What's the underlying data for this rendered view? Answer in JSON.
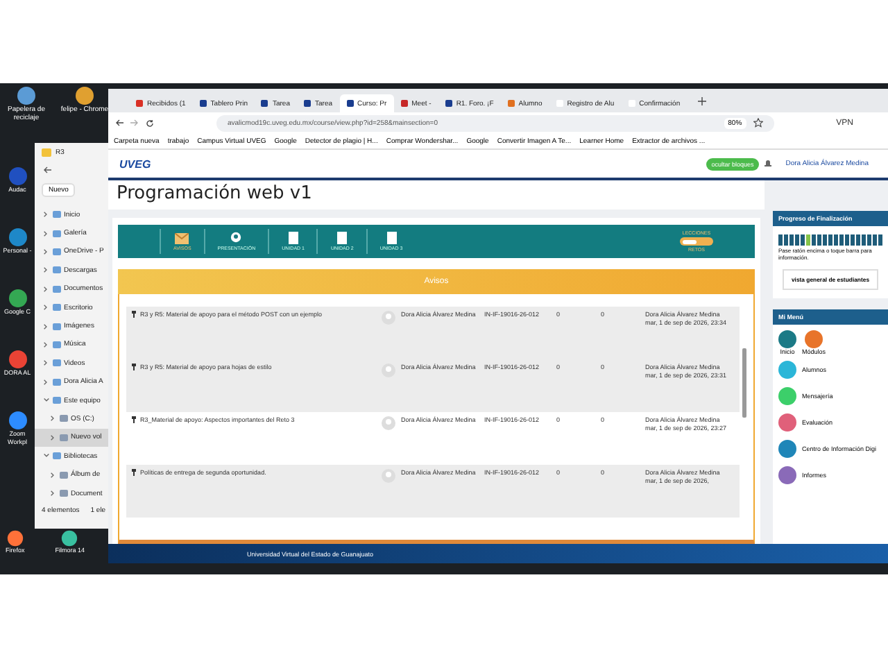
{
  "desktop_icons": [
    {
      "label": "Papelera de reciclaje",
      "color": "#5b9bd5"
    },
    {
      "label": "felipe - Chrome",
      "color": "#e0a030"
    }
  ],
  "desktop_side_icons": [
    {
      "label": "Audac",
      "color": "#2050c0"
    },
    {
      "label": "Personal -",
      "color": "#1e88c8"
    },
    {
      "label": "Google C",
      "color": "#34a853"
    },
    {
      "label": "DORA AL",
      "color": "#ea4335"
    },
    {
      "label": "Zoom Workpl",
      "color": "#2d8cff"
    }
  ],
  "desktop_bottom_icons": [
    {
      "label": "Firefox",
      "color": "#ff7139"
    },
    {
      "label": "Filmora 14",
      "color": "#39c0a0"
    }
  ],
  "explorer": {
    "title": "R3",
    "new_button": "Nuevo",
    "tree": [
      {
        "label": "Inicio",
        "expanded": false
      },
      {
        "label": "Galería",
        "expanded": false
      },
      {
        "label": "OneDrive - P",
        "expanded": false
      },
      {
        "label": "Descargas",
        "expanded": false
      },
      {
        "label": "Documentos",
        "expanded": false
      },
      {
        "label": "Escritorio",
        "expanded": false
      },
      {
        "label": "Imágenes",
        "expanded": false
      },
      {
        "label": "Música",
        "expanded": false
      },
      {
        "label": "Videos",
        "expanded": false
      },
      {
        "label": "Dora Alicia A",
        "expanded": false
      },
      {
        "label": "Este equipo",
        "expanded": true,
        "children": [
          {
            "label": "OS (C:)",
            "selected": false
          },
          {
            "label": "Nuevo vol",
            "selected": true
          }
        ]
      },
      {
        "label": "Bibliotecas",
        "expanded": true,
        "children": [
          {
            "label": "Álbum de",
            "selected": false
          },
          {
            "label": "Document",
            "selected": false
          }
        ]
      }
    ],
    "status": [
      "4 elementos",
      "1 ele"
    ]
  },
  "browser": {
    "tabs": [
      {
        "label": "Recibidos (1",
        "selected": false,
        "color": "#d93025"
      },
      {
        "label": "Tablero Prin",
        "selected": false,
        "color": "#1a3d8f"
      },
      {
        "label": "Tarea",
        "selected": false,
        "color": "#1a3d8f"
      },
      {
        "label": "Tarea",
        "selected": false,
        "color": "#1a3d8f"
      },
      {
        "label": "Curso: Pr",
        "selected": true,
        "color": "#1a3d8f"
      },
      {
        "label": "Meet -",
        "selected": false,
        "color": "#c62828"
      },
      {
        "label": "R1. Foro. ¡F",
        "selected": false,
        "color": "#1a3d8f"
      },
      {
        "label": "Alumno",
        "selected": false,
        "color": "#e07020"
      },
      {
        "label": "Registro de Alu",
        "selected": false,
        "color": "#ffffff"
      },
      {
        "label": "Confirmación",
        "selected": false,
        "color": "#ffffff"
      }
    ],
    "address": "avalicmod19c.uveg.edu.mx/course/view.php?id=258&mainsection=0",
    "zoom": "80%",
    "vpn": "VPN",
    "bookmarks": [
      "Carpeta nueva",
      "trabajo",
      "Campus Virtual UVEG",
      "Google",
      "Detector de plagio | H...",
      "Comprar Wondershar...",
      "Google",
      "Convertir Imagen A Te...",
      "Learner Home",
      "Extractor de archivos ..."
    ]
  },
  "page": {
    "logo": "UVEG",
    "hide_blocks": "ocultar bloques",
    "user": "Dora Alicia Álvarez Medina",
    "title": "Programación web v1",
    "nav": [
      {
        "label": "AVISOS",
        "selected": true,
        "kind": "mail"
      },
      {
        "label": "PRESENTACIÓN",
        "selected": false,
        "kind": "person"
      },
      {
        "label": "UNIDAD 1",
        "selected": false,
        "kind": "unit"
      },
      {
        "label": "UNIDAD 2",
        "selected": false,
        "kind": "unit"
      },
      {
        "label": "UNIDAD 3",
        "selected": false,
        "kind": "unit"
      }
    ],
    "switch": {
      "top": "LECCIONES",
      "bottom": "RETOS",
      "on": true
    },
    "section": "Avisos",
    "rows": [
      {
        "title": "R3 y R5: Material de apoyo para el método POST con un ejemplo",
        "author": "Dora Alicia Álvarez Medina",
        "group": "IN-IF-19016-26-012",
        "replies": "0",
        "unread": "0",
        "last_author": "Dora Alicia Álvarez Medina",
        "last_date": "mar, 1 de sep de 2026, 23:34",
        "shaded": true
      },
      {
        "title": "R3 y R5: Material de apoyo para hojas de estilo",
        "author": "Dora Alicia Álvarez Medina",
        "group": "IN-IF-19016-26-012",
        "replies": "0",
        "unread": "0",
        "last_author": "Dora Alicia Álvarez Medina",
        "last_date": "mar, 1 de sep de 2026, 23:31",
        "shaded": true
      },
      {
        "title": "R3_Material de apoyo: Aspectos importantes del Reto 3",
        "author": "Dora Alicia Álvarez Medina",
        "group": "IN-IF-19016-26-012",
        "replies": "0",
        "unread": "0",
        "last_author": "Dora Alicia Álvarez Medina",
        "last_date": "mar, 1 de sep de 2026, 23:27",
        "shaded": false
      },
      {
        "title": "Políticas de entrega de segunda oportunidad.",
        "author": "Dora Alicia Álvarez Medina",
        "group": "IN-IF-19016-26-012",
        "replies": "0",
        "unread": "0",
        "last_author": "Dora Alicia Álvarez Medina",
        "last_date": "mar, 1 de sep de 2026,",
        "shaded": true
      }
    ],
    "progress": {
      "title": "Progreso de Finalización",
      "blocks": [
        {
          "completed": false
        },
        {
          "completed": false
        },
        {
          "completed": false
        },
        {
          "completed": false
        },
        {
          "completed": false
        },
        {
          "completed": true
        },
        {
          "completed": false
        },
        {
          "completed": false
        },
        {
          "completed": false
        },
        {
          "completed": false
        },
        {
          "completed": false
        },
        {
          "completed": false
        },
        {
          "completed": false
        },
        {
          "completed": false
        },
        {
          "completed": false
        },
        {
          "completed": false
        },
        {
          "completed": false
        },
        {
          "completed": false
        },
        {
          "completed": false
        }
      ],
      "note": "Pase ratón encima o toque barra para información.",
      "button": "vista general de estudiantes"
    },
    "menu": {
      "title": "Mi Menú",
      "top_items": [
        {
          "label": "Inicio",
          "color": "#1b7a86"
        },
        {
          "label": "Módulos",
          "color": "#e8742a"
        }
      ],
      "items": [
        {
          "label": "Alumnos",
          "color": "#2bb6d8"
        },
        {
          "label": "Mensajería",
          "color": "#3ccf6a"
        },
        {
          "label": "Evaluación",
          "color": "#e0607a"
        },
        {
          "label": "Centro de Información Digi",
          "color": "#1f86b8"
        },
        {
          "label": "Informes",
          "color": "#8a6ab8"
        }
      ]
    },
    "footer": "Universidad Virtual del Estado de Guanajuato"
  }
}
